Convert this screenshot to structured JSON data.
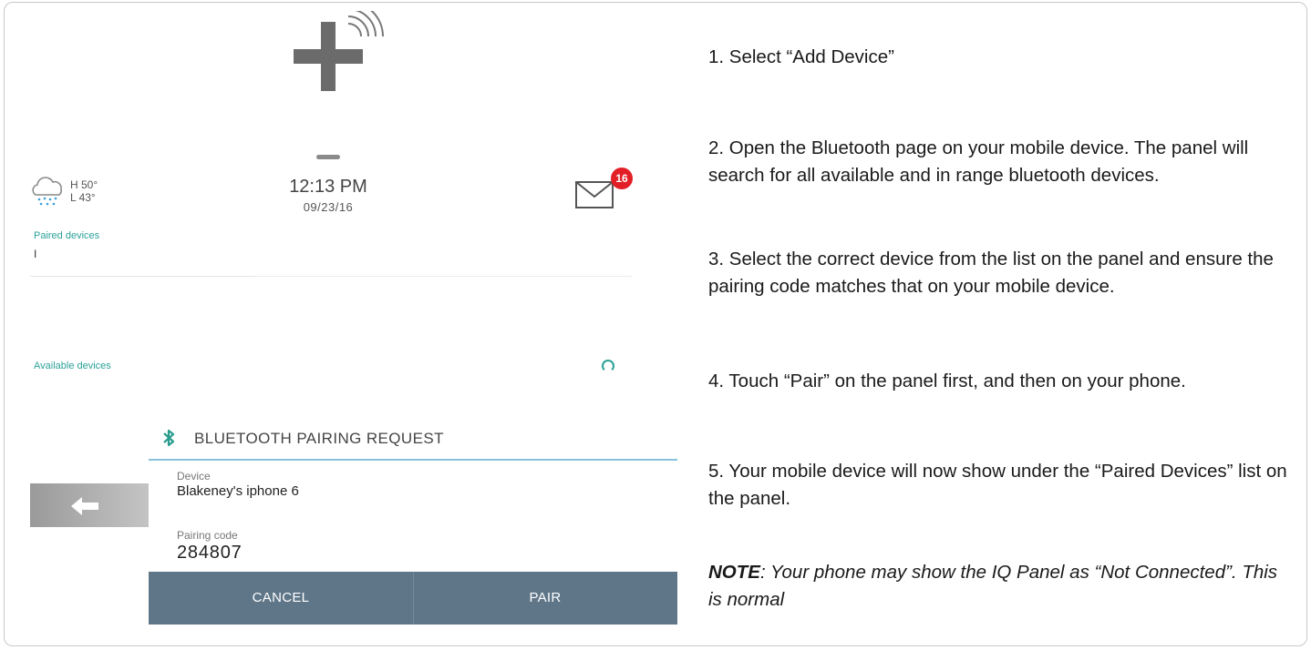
{
  "panel": {
    "weather": {
      "high": "H 50°",
      "low": "L 43°",
      "icon": "rain-cloud-icon"
    },
    "clock": {
      "time": "12:13 PM",
      "date": "09/23/16"
    },
    "messages": {
      "count": "16",
      "icon": "mail-icon"
    },
    "paired_devices": {
      "label": "Paired devices",
      "first_item": "I"
    },
    "available_devices": {
      "label": "Available devices"
    },
    "dialog": {
      "title": "BLUETOOTH PAIRING REQUEST",
      "device_label": "Device",
      "device_value": "Blakeney's iphone 6",
      "code_label": "Pairing code",
      "code_value": "284807",
      "cancel_label": "CANCEL",
      "pair_label": "PAIR"
    }
  },
  "instructions": {
    "steps": [
      "1. Select “Add Device”",
      "2. Open the Bluetooth page on your mobile device. The panel will search for all available and in range bluetooth devices.",
      "3. Select the correct device from the list on the panel and ensure the pairing code matches that on your mobile device.",
      "4. Touch “Pair” on the panel first, and then on your phone.",
      "5.  Your mobile device will now show under the “Paired Devices” list on the panel."
    ],
    "note_label": "NOTE",
    "note_text": ": Your phone may show the IQ Panel as “Not Connected”. This is normal"
  },
  "colors": {
    "accent_teal": "#2aa198",
    "button_bar": "#5f7689",
    "badge_red": "#e21f26",
    "dialog_divider": "#87c2de"
  }
}
